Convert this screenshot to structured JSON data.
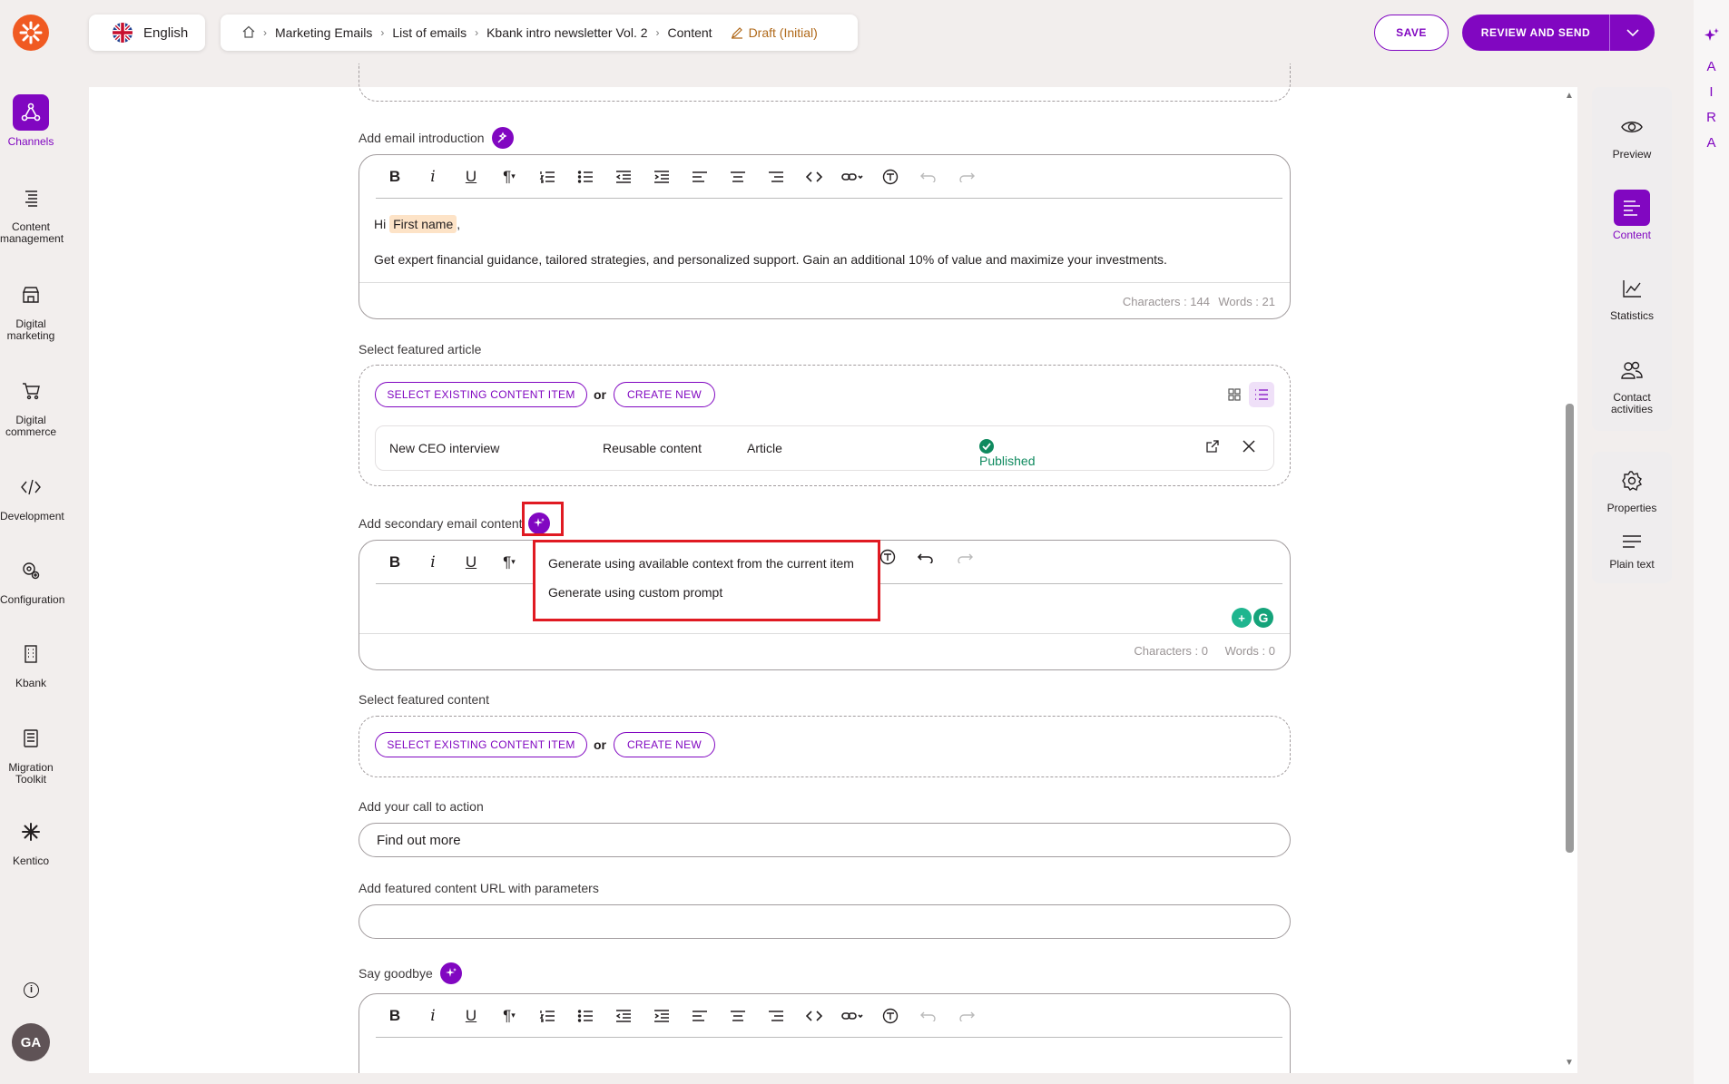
{
  "top": {
    "language": "English",
    "breadcrumbs": [
      "Marketing Emails",
      "List of emails",
      "Kbank intro newsletter Vol. 2",
      "Content"
    ],
    "status": "Draft (Initial)",
    "save_label": "SAVE",
    "review_label": "REVIEW AND SEND"
  },
  "leftnav": {
    "items": [
      {
        "label": "Channels",
        "icon": "channels-icon"
      },
      {
        "label": "Content management",
        "icon": "content-management-icon"
      },
      {
        "label": "Digital marketing",
        "icon": "digital-marketing-icon"
      },
      {
        "label": "Digital commerce",
        "icon": "cart-icon"
      },
      {
        "label": "Development",
        "icon": "code-icon"
      },
      {
        "label": "Configuration",
        "icon": "gear-icon"
      },
      {
        "label": "Kbank",
        "icon": "building-icon"
      },
      {
        "label": "Migration Toolkit",
        "icon": "migration-icon"
      },
      {
        "label": "Kentico",
        "icon": "kentico-icon"
      }
    ],
    "avatar": "GA"
  },
  "aira": [
    "A",
    "I",
    "R",
    "A"
  ],
  "rightpanel": {
    "items": [
      "Preview",
      "Content",
      "Statistics",
      "Contact activities"
    ],
    "items2": [
      "Properties",
      "Plain text"
    ]
  },
  "form": {
    "intro_label": "Add email introduction",
    "intro_hi": "Hi",
    "intro_token": "First name",
    "intro_comma": ",",
    "intro_body": "Get expert financial guidance, tailored strategies, and personalized support. Gain an additional 10% of value and maximize your investments.",
    "intro_chars": "Characters : 144",
    "intro_words": "Words : 21",
    "article_label": "Select featured article",
    "select_existing": "SELECT EXISTING CONTENT ITEM",
    "or": "or",
    "create_new": "CREATE NEW",
    "article_row": {
      "name": "New CEO interview",
      "type": "Reusable content",
      "kind": "Article",
      "status": "Published"
    },
    "secondary_label": "Add secondary email content",
    "secondary_chars": "Characters : 0",
    "secondary_words": "Words : 0",
    "ai_menu": [
      "Generate using available context from the current item",
      "Generate using custom prompt"
    ],
    "featured_label": "Select featured content",
    "cta_label": "Add your call to action",
    "cta_value": "Find out more",
    "url_label": "Add featured content URL with parameters",
    "url_value": "",
    "goodbye_label": "Say goodbye"
  },
  "colors": {
    "accent": "#8107c1",
    "brand": "#f05a22",
    "highlight": "#e01a22",
    "published": "#0f8a5f"
  }
}
